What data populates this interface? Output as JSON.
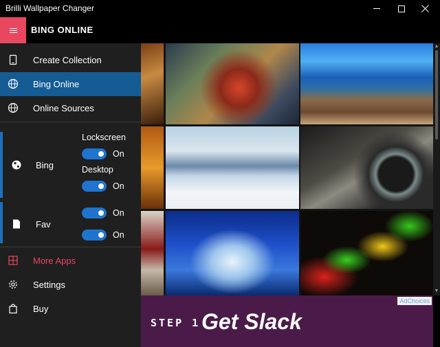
{
  "window": {
    "title": "Brilli Wallpaper Changer"
  },
  "header": {
    "title": "BING ONLINE"
  },
  "nav": {
    "create": "Create Collection",
    "bing_online": "Bing Online",
    "online_sources": "Online Sources",
    "more_apps": "More Apps",
    "settings": "Settings",
    "buy": "Buy"
  },
  "sources": {
    "bing": {
      "name": "Bing",
      "lockscreen_label": "Lockscreen",
      "lockscreen_state": "On",
      "desktop_label": "Desktop",
      "desktop_state": "On"
    },
    "fav": {
      "name": "Fav",
      "toggle1_state": "On",
      "toggle2_state": "On"
    }
  },
  "ad": {
    "choices": "AdChoices",
    "step": "STEP 1",
    "headline": "Get Slack"
  },
  "colors": {
    "accent": "#e8475f",
    "selected": "#155b94",
    "toggle": "#1e74cf",
    "sidebar": "#1f1f1f",
    "ad_bg": "#4a1b49"
  }
}
